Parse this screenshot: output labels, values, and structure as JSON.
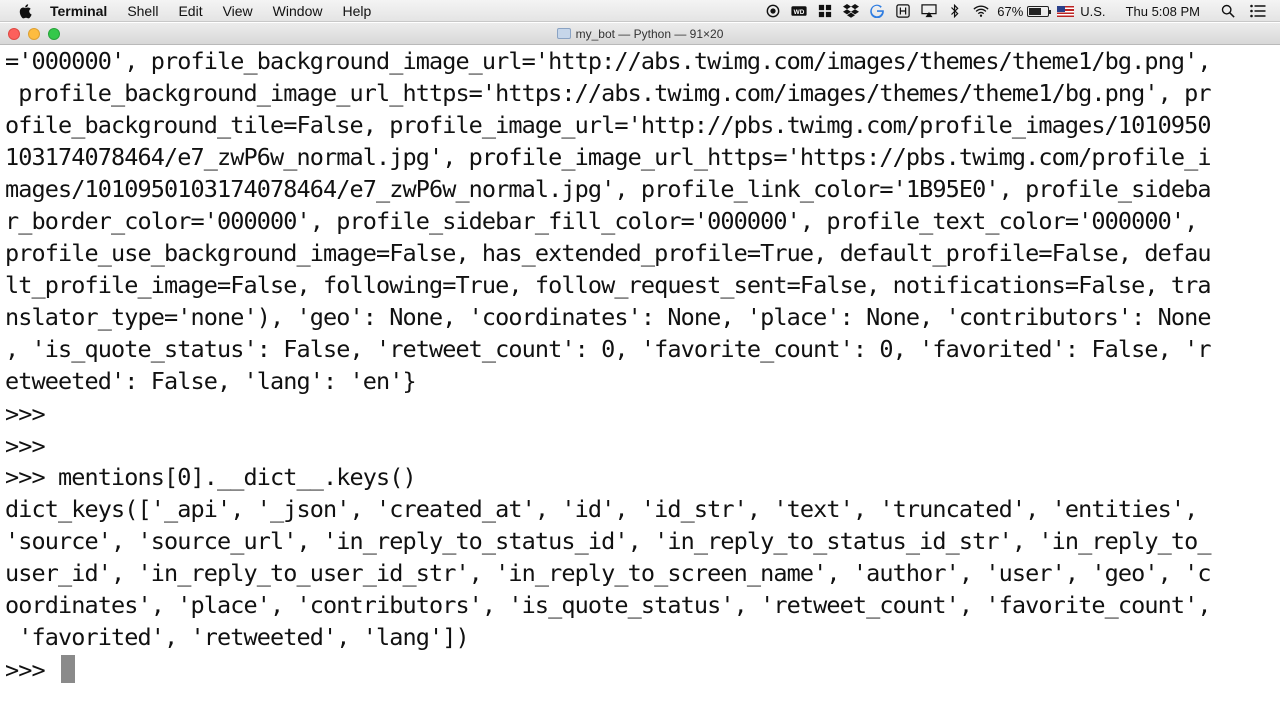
{
  "menubar": {
    "app_name": "Terminal",
    "items": [
      "Shell",
      "Edit",
      "View",
      "Window",
      "Help"
    ],
    "status": {
      "battery_percent_label": "67%",
      "battery_level": 0.67,
      "input_source": "U.S.",
      "clock": "Thu 5:08 PM"
    }
  },
  "window": {
    "title": "my_bot — Python — 91×20"
  },
  "terminal": {
    "lines": [
      "='000000', profile_background_image_url='http://abs.twimg.com/images/themes/theme1/bg.png',",
      " profile_background_image_url_https='https://abs.twimg.com/images/themes/theme1/bg.png', pr",
      "ofile_background_tile=False, profile_image_url='http://pbs.twimg.com/profile_images/1010950",
      "103174078464/e7_zwP6w_normal.jpg', profile_image_url_https='https://pbs.twimg.com/profile_i",
      "mages/1010950103174078464/e7_zwP6w_normal.jpg', profile_link_color='1B95E0', profile_sideba",
      "r_border_color='000000', profile_sidebar_fill_color='000000', profile_text_color='000000',",
      "profile_use_background_image=False, has_extended_profile=True, default_profile=False, defau",
      "lt_profile_image=False, following=True, follow_request_sent=False, notifications=False, tra",
      "nslator_type='none'), 'geo': None, 'coordinates': None, 'place': None, 'contributors': None",
      ", 'is_quote_status': False, 'retweet_count': 0, 'favorite_count': 0, 'favorited': False, 'r",
      "etweeted': False, 'lang': 'en'}",
      ">>>",
      ">>>",
      ">>> mentions[0].__dict__.keys()",
      "dict_keys(['_api', '_json', 'created_at', 'id', 'id_str', 'text', 'truncated', 'entities',",
      "'source', 'source_url', 'in_reply_to_status_id', 'in_reply_to_status_id_str', 'in_reply_to_",
      "user_id', 'in_reply_to_user_id_str', 'in_reply_to_screen_name', 'author', 'user', 'geo', 'c",
      "oordinates', 'place', 'contributors', 'is_quote_status', 'retweet_count', 'favorite_count',",
      " 'favorited', 'retweeted', 'lang'])",
      ">>> "
    ]
  },
  "icons": [
    "apple-icon",
    "record-icon",
    "wd-drive-icon",
    "grid-icon",
    "dropbox-icon",
    "google-drive-icon",
    "keyboard-icon",
    "airplay-icon",
    "bluetooth-icon",
    "wifi-icon",
    "battery-icon",
    "flag-icon",
    "search-icon",
    "list-icon"
  ]
}
